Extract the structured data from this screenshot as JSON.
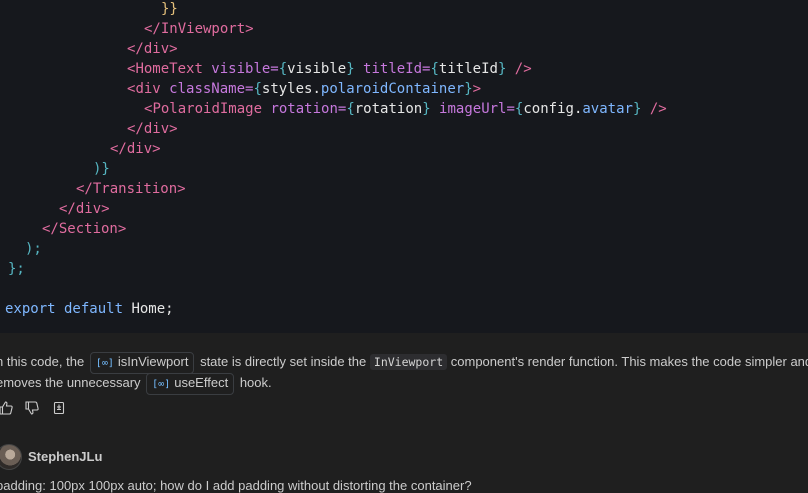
{
  "code": {
    "l1": {
      "a": "}}"
    },
    "l2": {
      "a": "</",
      "b": "InViewport",
      "c": ">"
    },
    "l3": {
      "a": "</",
      "b": "div",
      "c": ">"
    },
    "l4": {
      "a": "<",
      "b": "HomeText",
      "c": " visible=",
      "d": "{",
      "e": "visible",
      "f": "}",
      "g": " titleId=",
      "h": "{",
      "i": "titleId",
      "j": "}",
      "k": " />"
    },
    "l5": {
      "a": "<",
      "b": "div",
      "c": " className=",
      "d": "{",
      "e": "styles",
      "f": ".",
      "g": "polaroidContainer",
      "h": "}",
      "i": ">"
    },
    "l6": {
      "a": "<",
      "b": "PolaroidImage",
      "c": " rotation=",
      "d": "{",
      "e": "rotation",
      "f": "}",
      "g": " imageUrl=",
      "h": "{",
      "i": "config",
      "j": ".",
      "k": "avatar",
      "l": "}",
      "m": " />"
    },
    "l7": {
      "a": "</",
      "b": "div",
      "c": ">"
    },
    "l8": {
      "a": "</",
      "b": "div",
      "c": ">"
    },
    "l9": {
      "a": ")}"
    },
    "l10": {
      "a": "</",
      "b": "Transition",
      "c": ">"
    },
    "l11": {
      "a": "</",
      "b": "div",
      "c": ">"
    },
    "l12": {
      "a": "</",
      "b": "Section",
      "c": ">"
    },
    "l13": {
      "a": ");"
    },
    "l14": {
      "a": "};"
    },
    "l15": {
      "a": "export",
      "b": " default ",
      "c": "Home;"
    }
  },
  "message": {
    "p1_a": "n this code, the",
    "chip1_symbol": "[∞]",
    "chip1_label": "isInViewport",
    "p1_b": "state is directly set inside the",
    "code1": "InViewport",
    "p1_c": "component's render function. This makes the code simpler and",
    "p2_a": "emoves the unnecessary",
    "chip2_symbol": "[∞]",
    "chip2_label": "useEffect",
    "p2_b": "hook."
  },
  "user": {
    "name": "StephenJLu",
    "question": "padding: 100px 100px auto; how do I add padding without distorting the container?"
  },
  "icons": [
    "thumbs-up-icon",
    "thumbs-down-icon",
    "insert-into-editor-icon"
  ]
}
